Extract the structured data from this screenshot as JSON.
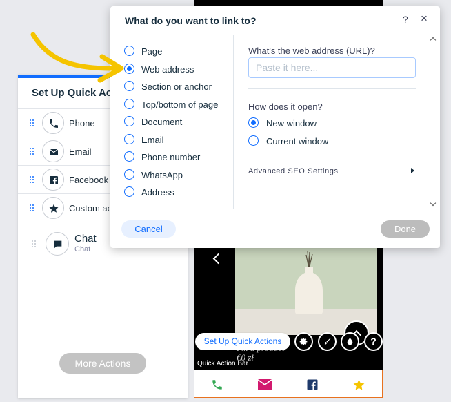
{
  "colors": {
    "accent": "#116dff",
    "annotation_arrow": "#f5c400",
    "quick_action_bar_border": "#e8721f",
    "phone_icon": "#34a853",
    "email_icon": "#d2196e",
    "facebook_icon": "#1f3a6b",
    "star_icon": "#f5c400"
  },
  "left_panel": {
    "title": "Set Up Quick Acti",
    "actions": [
      {
        "icon": "phone-icon",
        "label": "Phone"
      },
      {
        "icon": "email-icon",
        "label": "Email"
      },
      {
        "icon": "facebook-icon",
        "label": "Facebook"
      },
      {
        "icon": "star-icon",
        "label": "Custom ac"
      }
    ],
    "chat": {
      "icon": "chat-icon",
      "label": "Chat",
      "sublabel": "Chat"
    },
    "more_actions_label": "More Actions"
  },
  "preview": {
    "product_text_line1": "I'm a product",
    "product_text_line2": "€0 zł",
    "setup_button_label": "Set Up Quick Actions",
    "quick_action_bar_label": "Quick Action Bar",
    "toolbar_icons": [
      "gear-icon",
      "brush-icon",
      "drop-icon",
      "help-icon"
    ],
    "help_label": "?",
    "bar_icons": [
      "phone-icon",
      "email-icon",
      "facebook-icon",
      "star-icon"
    ]
  },
  "dialog": {
    "title": "What do you want to link to?",
    "help_label": "?",
    "close_label": "×",
    "link_types": [
      {
        "label": "Page",
        "selected": false
      },
      {
        "label": "Web address",
        "selected": true
      },
      {
        "label": "Section or anchor",
        "selected": false
      },
      {
        "label": "Top/bottom of page",
        "selected": false
      },
      {
        "label": "Document",
        "selected": false
      },
      {
        "label": "Email",
        "selected": false
      },
      {
        "label": "Phone number",
        "selected": false
      },
      {
        "label": "WhatsApp",
        "selected": false
      },
      {
        "label": "Address",
        "selected": false
      }
    ],
    "url_label": "What's the web address (URL)?",
    "url_value": "",
    "url_placeholder": "Paste it here...",
    "open_label": "How does it open?",
    "open_options": [
      {
        "label": "New window",
        "selected": true
      },
      {
        "label": "Current window",
        "selected": false
      }
    ],
    "seo_label": "Advanced SEO Settings",
    "cancel_label": "Cancel",
    "done_label": "Done"
  }
}
